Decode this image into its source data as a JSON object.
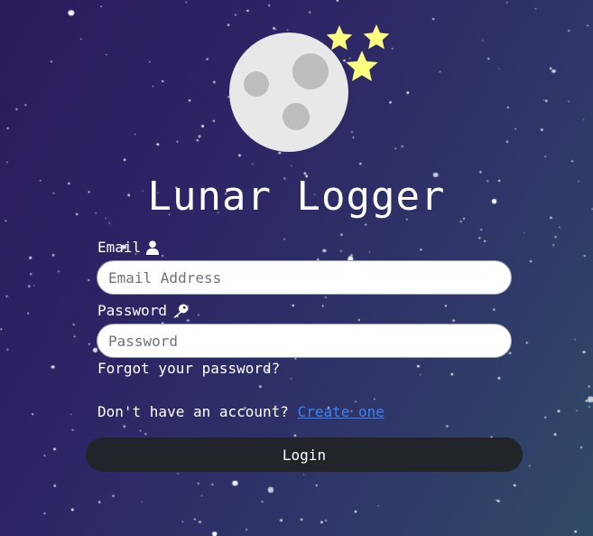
{
  "app": {
    "title": "Lunar Logger"
  },
  "form": {
    "email": {
      "label": "Email",
      "placeholder": "Email Address",
      "value": "",
      "icon": "user-icon"
    },
    "password": {
      "label": "Password",
      "placeholder": "Password",
      "value": "",
      "icon": "key-icon"
    },
    "forgot_link": "Forgot your password?",
    "signup_prompt": "Don't have an account?",
    "signup_link": "Create one",
    "login_label": "Login"
  },
  "logo": {
    "icons": [
      "moon-icon",
      "star-icon",
      "star-icon",
      "star-icon"
    ],
    "moon_color": "#e8e8e8",
    "crater_color": "#bdbdbd",
    "star_color": "#ffff80"
  },
  "colors": {
    "background_start": "#2b1a5c",
    "background_end": "#304a66",
    "link": "#3b82f6",
    "button": "#212529"
  }
}
